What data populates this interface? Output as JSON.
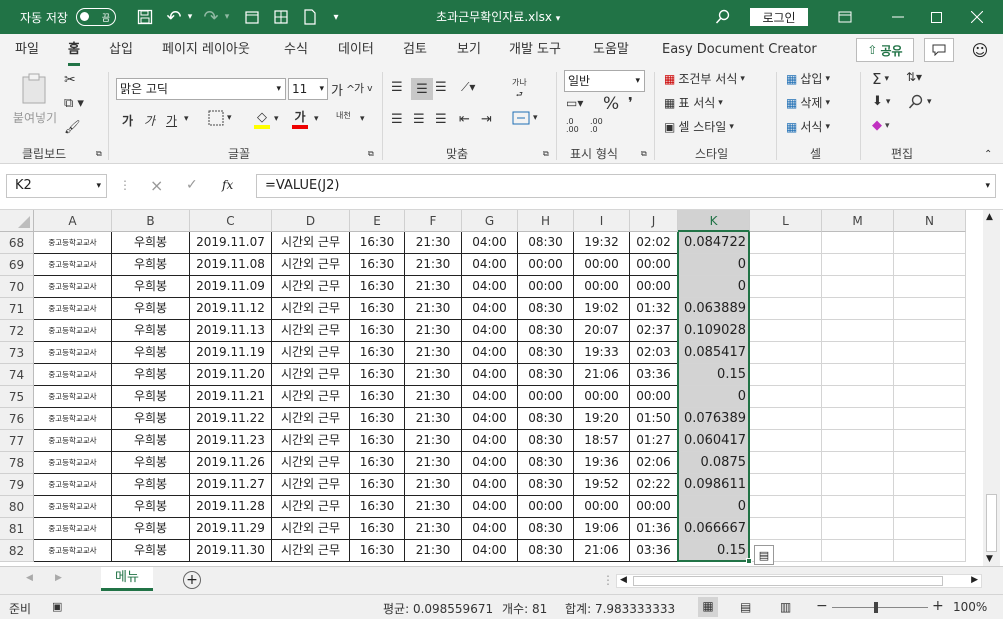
{
  "titlebar": {
    "autosave_label": "자동 저장",
    "autosave_state": "끔",
    "doc_title": "초과근무확인자료.xlsx",
    "login_label": "로그인"
  },
  "menu": {
    "tabs": [
      "파일",
      "홈",
      "삽입",
      "페이지 레이아웃",
      "수식",
      "데이터",
      "검토",
      "보기",
      "개발 도구",
      "도움말",
      "Easy Document Creator"
    ],
    "active": "홈",
    "share_label": "공유"
  },
  "ribbon": {
    "clipboard": {
      "paste_label": "붙여넣기",
      "group": "클립보드"
    },
    "font": {
      "name": "맑은 고딕",
      "size": "11",
      "group": "글꼴",
      "bold": "가",
      "italic": "가",
      "underline": "가",
      "grow": "가",
      "shrink": "가",
      "color_a": "가",
      "phonetic": "내천"
    },
    "align": {
      "group": "맞춤",
      "wrap": "가나"
    },
    "number": {
      "format": "일반",
      "group": "표시 형식"
    },
    "styles": {
      "conditional": "조건부 서식",
      "table": "표 서식",
      "cell": "셀 스타일",
      "group": "스타일"
    },
    "cells": {
      "insert": "삽입",
      "delete": "삭제",
      "format": "서식",
      "group": "셀"
    },
    "edit": {
      "group": "편집"
    }
  },
  "formula_bar": {
    "name_box": "K2",
    "cancel": "×",
    "enter": "✓",
    "fx": "fx",
    "formula": "=VALUE(J2)"
  },
  "columns": [
    "A",
    "B",
    "C",
    "D",
    "E",
    "F",
    "G",
    "H",
    "I",
    "J",
    "K",
    "L",
    "M",
    "N"
  ],
  "selected_column": "K",
  "rows": [
    {
      "n": "68",
      "a": "중고등학교교사",
      "b": "우희봉",
      "c": "2019.11.07",
      "d": "시간외 근무",
      "e": "16:30",
      "f": "21:30",
      "g": "04:00",
      "h": "08:30",
      "i": "19:32",
      "j": "02:02",
      "k": "0.084722"
    },
    {
      "n": "69",
      "a": "중고등학교교사",
      "b": "우희봉",
      "c": "2019.11.08",
      "d": "시간외 근무",
      "e": "16:30",
      "f": "21:30",
      "g": "04:00",
      "h": "00:00",
      "i": "00:00",
      "j": "00:00",
      "k": "0"
    },
    {
      "n": "70",
      "a": "중고등학교교사",
      "b": "우희봉",
      "c": "2019.11.09",
      "d": "시간외 근무",
      "e": "16:30",
      "f": "21:30",
      "g": "04:00",
      "h": "00:00",
      "i": "00:00",
      "j": "00:00",
      "k": "0"
    },
    {
      "n": "71",
      "a": "중고등학교교사",
      "b": "우희봉",
      "c": "2019.11.12",
      "d": "시간외 근무",
      "e": "16:30",
      "f": "21:30",
      "g": "04:00",
      "h": "08:30",
      "i": "19:02",
      "j": "01:32",
      "k": "0.063889"
    },
    {
      "n": "72",
      "a": "중고등학교교사",
      "b": "우희봉",
      "c": "2019.11.13",
      "d": "시간외 근무",
      "e": "16:30",
      "f": "21:30",
      "g": "04:00",
      "h": "08:30",
      "i": "20:07",
      "j": "02:37",
      "k": "0.109028"
    },
    {
      "n": "73",
      "a": "중고등학교교사",
      "b": "우희봉",
      "c": "2019.11.19",
      "d": "시간외 근무",
      "e": "16:30",
      "f": "21:30",
      "g": "04:00",
      "h": "08:30",
      "i": "19:33",
      "j": "02:03",
      "k": "0.085417"
    },
    {
      "n": "74",
      "a": "중고등학교교사",
      "b": "우희봉",
      "c": "2019.11.20",
      "d": "시간외 근무",
      "e": "16:30",
      "f": "21:30",
      "g": "04:00",
      "h": "08:30",
      "i": "21:06",
      "j": "03:36",
      "k": "0.15"
    },
    {
      "n": "75",
      "a": "중고등학교교사",
      "b": "우희봉",
      "c": "2019.11.21",
      "d": "시간외 근무",
      "e": "16:30",
      "f": "21:30",
      "g": "04:00",
      "h": "00:00",
      "i": "00:00",
      "j": "00:00",
      "k": "0"
    },
    {
      "n": "76",
      "a": "중고등학교교사",
      "b": "우희봉",
      "c": "2019.11.22",
      "d": "시간외 근무",
      "e": "16:30",
      "f": "21:30",
      "g": "04:00",
      "h": "08:30",
      "i": "19:20",
      "j": "01:50",
      "k": "0.076389"
    },
    {
      "n": "77",
      "a": "중고등학교교사",
      "b": "우희봉",
      "c": "2019.11.23",
      "d": "시간외 근무",
      "e": "16:30",
      "f": "21:30",
      "g": "04:00",
      "h": "08:30",
      "i": "18:57",
      "j": "01:27",
      "k": "0.060417"
    },
    {
      "n": "78",
      "a": "중고등학교교사",
      "b": "우희봉",
      "c": "2019.11.26",
      "d": "시간외 근무",
      "e": "16:30",
      "f": "21:30",
      "g": "04:00",
      "h": "08:30",
      "i": "19:36",
      "j": "02:06",
      "k": "0.0875"
    },
    {
      "n": "79",
      "a": "중고등학교교사",
      "b": "우희봉",
      "c": "2019.11.27",
      "d": "시간외 근무",
      "e": "16:30",
      "f": "21:30",
      "g": "04:00",
      "h": "08:30",
      "i": "19:52",
      "j": "02:22",
      "k": "0.098611"
    },
    {
      "n": "80",
      "a": "중고등학교교사",
      "b": "우희봉",
      "c": "2019.11.28",
      "d": "시간외 근무",
      "e": "16:30",
      "f": "21:30",
      "g": "04:00",
      "h": "00:00",
      "i": "00:00",
      "j": "00:00",
      "k": "0"
    },
    {
      "n": "81",
      "a": "중고등학교교사",
      "b": "우희봉",
      "c": "2019.11.29",
      "d": "시간외 근무",
      "e": "16:30",
      "f": "21:30",
      "g": "04:00",
      "h": "08:30",
      "i": "19:06",
      "j": "01:36",
      "k": "0.066667"
    },
    {
      "n": "82",
      "a": "중고등학교교사",
      "b": "우희봉",
      "c": "2019.11.30",
      "d": "시간외 근무",
      "e": "16:30",
      "f": "21:30",
      "g": "04:00",
      "h": "08:30",
      "i": "21:06",
      "j": "03:36",
      "k": "0.15"
    }
  ],
  "sheets": {
    "active": "메뉴"
  },
  "status": {
    "ready": "준비",
    "average": "평균: 0.098559671",
    "count": "개수: 81",
    "sum": "합계: 7.983333333",
    "zoom": "100%"
  },
  "colors": {
    "accent": "#217346",
    "selected_col_bg": "#d3d3d3"
  }
}
